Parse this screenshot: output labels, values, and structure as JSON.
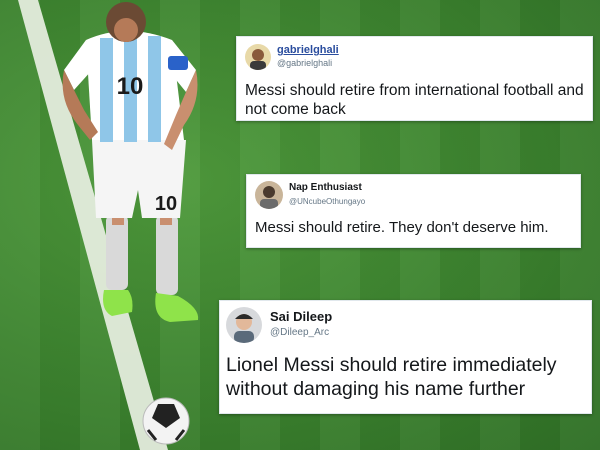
{
  "tweets": [
    {
      "display_name": "gabrielghali",
      "handle": "@gabrielghali",
      "text": "Messi should retire from international football and not come back"
    },
    {
      "display_name": "Nap Enthusiast",
      "handle": "@UNcubeOthungayo",
      "text": "Messi should retire. They don't deserve him."
    },
    {
      "display_name": "Sai Dileep",
      "handle": "@Dileep_Arc",
      "text": "Lionel Messi should retire immediately without damaging his name further"
    }
  ],
  "player": {
    "jersey_number": "10",
    "shorts_number": "10"
  },
  "colors": {
    "pitch": "#3f8731",
    "jersey_stripe": "#8fc6e8",
    "boots": "#8fe34a"
  }
}
